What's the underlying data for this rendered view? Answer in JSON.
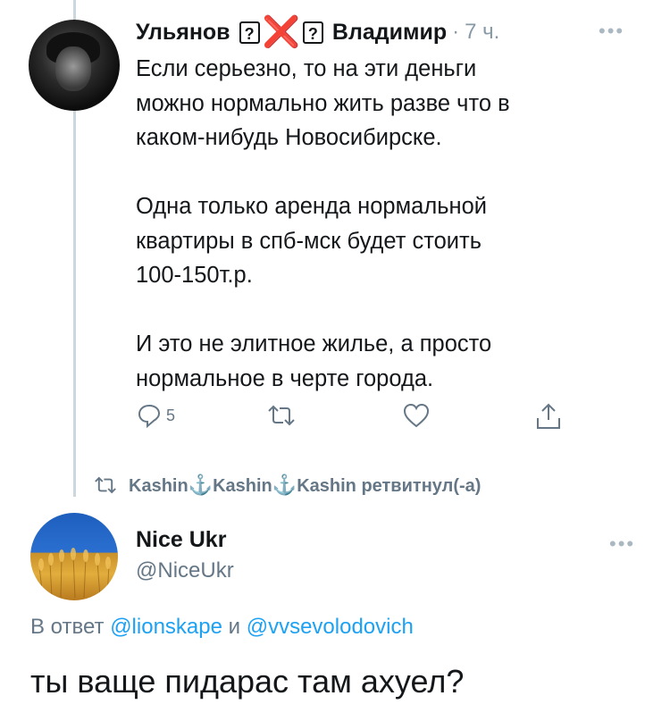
{
  "tweet1": {
    "name_part1": "Ульянов",
    "name_box1": "?",
    "name_cross": "❌",
    "name_box2": "?",
    "name_part2": "Владимир",
    "separator": "·",
    "time": "7 ч.",
    "more": "•••",
    "paragraphs": [
      [
        "Если серьезно, то на эти деньги",
        "можно нормально жить разве что в",
        "каком-нибудь Новосибирске."
      ],
      [
        "Одна только аренда нормальной",
        "квартиры в спб-мск будет стоить",
        "100-150т.р."
      ],
      [
        "И это не элитное жилье, а просто",
        "нормальное в черте города."
      ]
    ],
    "reply_count": "5"
  },
  "retweet": {
    "name1": "Kashin",
    "name2": "Kashin",
    "name3": "Kashin",
    "anchor": "⚓",
    "suffix": "ретвитнул(-а)"
  },
  "tweet2": {
    "name": "Nice Ukr",
    "handle": "@NiceUkr",
    "more": "•••",
    "reply_prefix": "В ответ",
    "mention1": "@lionskape",
    "conj": "и",
    "mention2": "@vvsevolodovich",
    "text": "ты ваще пидарас там ахуел?"
  }
}
